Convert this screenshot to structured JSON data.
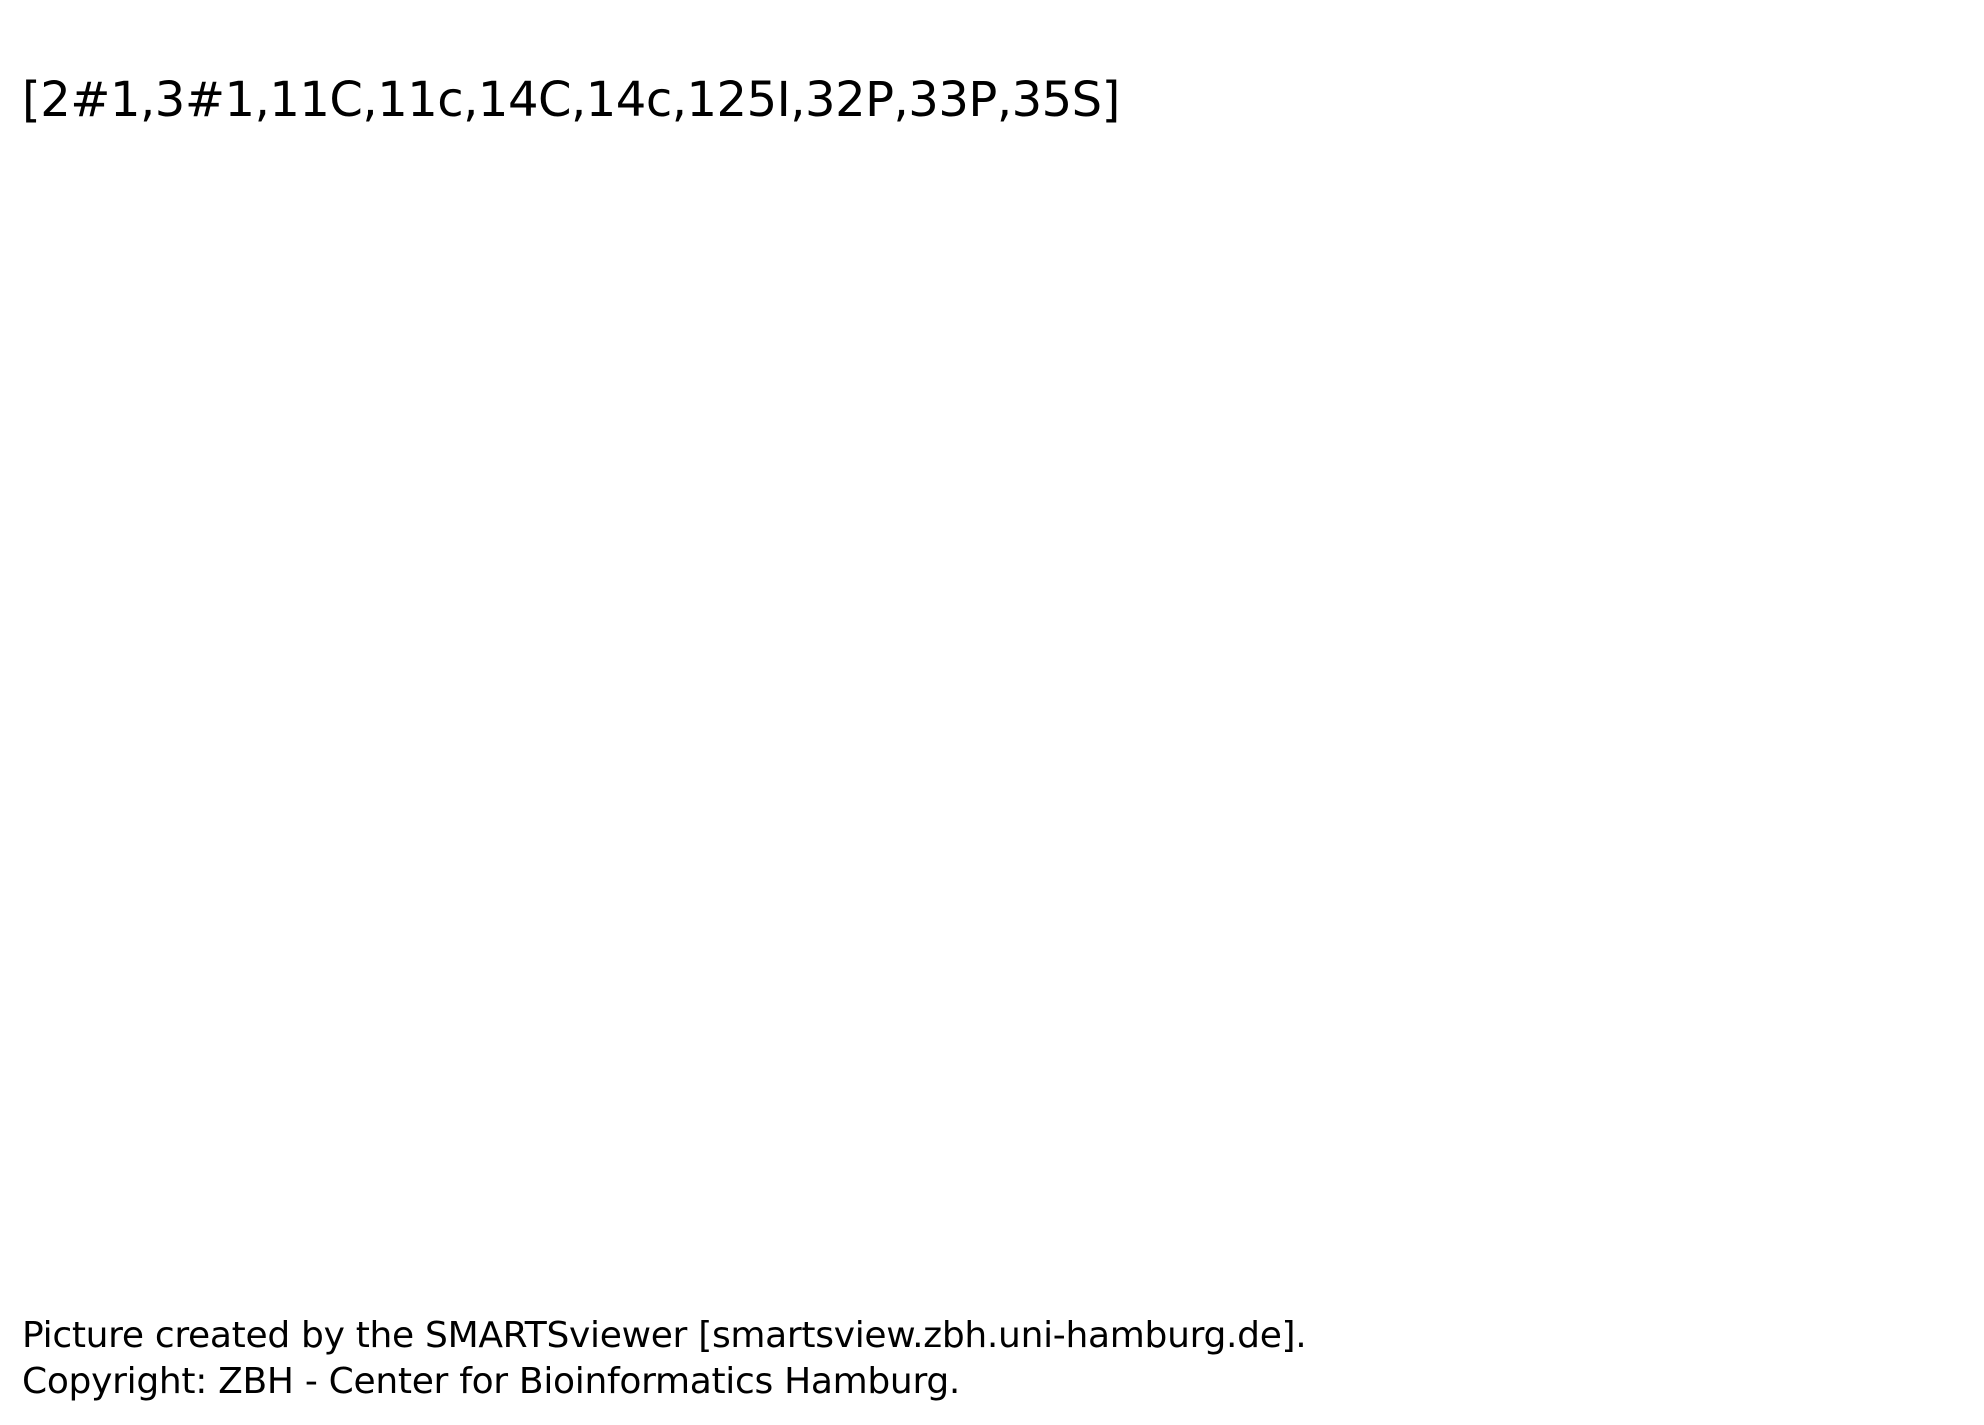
{
  "pattern": "[2#1,3#1,11C,11c,14C,14c,125I,32P,33P,35S]",
  "footer": {
    "line1": "Picture created by the SMARTSviewer [smartsview.zbh.uni-hamburg.de].",
    "line2": "Copyright: ZBH - Center for Bioinformatics Hamburg."
  }
}
